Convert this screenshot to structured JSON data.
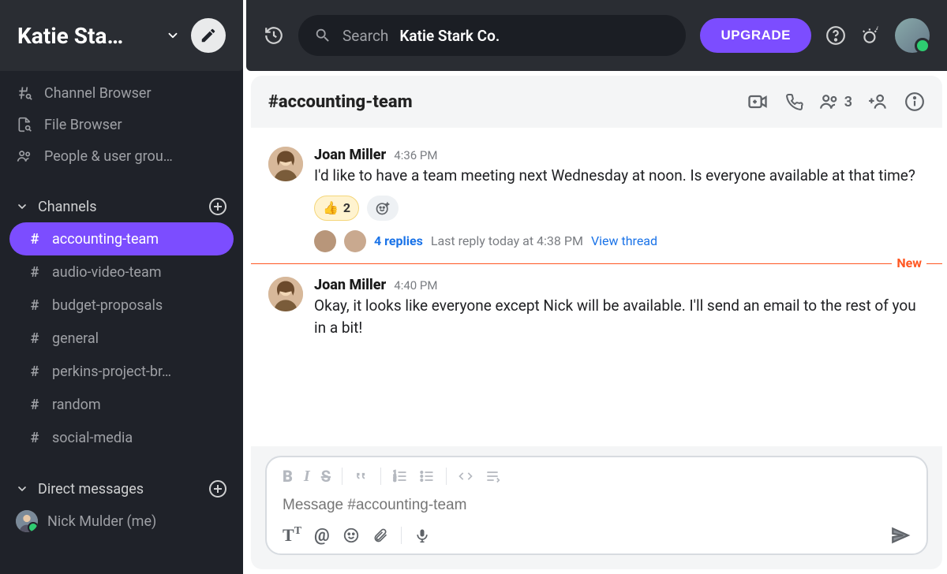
{
  "workspace": {
    "name": "Katie Sta…"
  },
  "sidebar": {
    "browse": [
      {
        "label": "Channel Browser"
      },
      {
        "label": "File Browser"
      },
      {
        "label": "People & user grou…"
      }
    ],
    "channels_title": "Channels",
    "channels": [
      {
        "name": "accounting-team",
        "active": true
      },
      {
        "name": "audio-video-team"
      },
      {
        "name": "budget-proposals"
      },
      {
        "name": "general"
      },
      {
        "name": "perkins-project-br…"
      },
      {
        "name": "random"
      },
      {
        "name": "social-media"
      }
    ],
    "dm_title": "Direct messages",
    "dms": [
      {
        "label": "Nick Mulder (me)"
      }
    ]
  },
  "topbar": {
    "search_prefix": "Search",
    "search_context": "Katie Stark Co.",
    "upgrade": "UPGRADE"
  },
  "channel": {
    "name": "#accounting-team",
    "member_count": "3"
  },
  "messages": [
    {
      "author": "Joan Miller",
      "time": "4:36 PM",
      "text": "I'd like to have a team meeting next Wednesday at noon. Is everyone available at that time?",
      "reaction_emoji": "👍",
      "reaction_count": "2",
      "thread_replies": "4 replies",
      "thread_meta": "Last reply today at 4:38 PM",
      "thread_view": "View thread"
    },
    {
      "author": "Joan Miller",
      "time": "4:40 PM",
      "text": "Okay, it looks like everyone except Nick will be available. I'll send an email to the rest of you in a bit!"
    }
  ],
  "divider": {
    "label": "New"
  },
  "composer": {
    "placeholder": "Message #accounting-team"
  }
}
